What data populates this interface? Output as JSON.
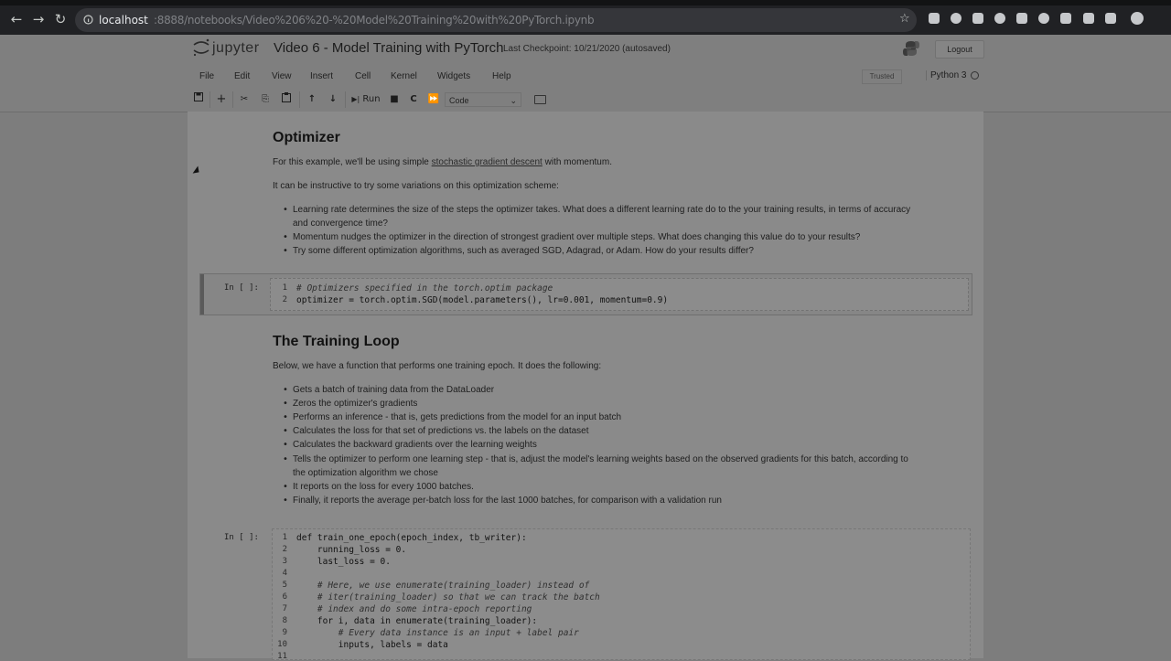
{
  "browser": {
    "url_host": "localhost",
    "url_path": ":8888/notebooks/Video%206%20-%20Model%20Training%20with%20PyTorch.ipynb",
    "buttons": {
      "back": "←",
      "forward": "→",
      "reload": "↻"
    },
    "icons": [
      "star-icon",
      "extension-icon",
      "profile-icon"
    ]
  },
  "header": {
    "logo_text": "jupyter",
    "notebook_title": "Video 6 - Model Training with PyTorch",
    "checkpoint": "Last Checkpoint: 10/21/2020  (autosaved)",
    "logout_label": "Logout"
  },
  "menu": {
    "items": [
      "File",
      "Edit",
      "View",
      "Insert",
      "Cell",
      "Kernel",
      "Widgets",
      "Help"
    ],
    "trusted_label": "Trusted",
    "kernel_name": "Python 3"
  },
  "toolbar": {
    "save": "💾",
    "add": "+",
    "cut": "✂",
    "copy": "⎘",
    "paste": "📋",
    "move_up": "↑",
    "move_down": "↓",
    "run_label": "Run",
    "interrupt": "■",
    "restart": "C",
    "restart_run": "⏩",
    "cell_type": "Code"
  },
  "cells": {
    "optimizer": {
      "heading": "Optimizer",
      "p1_before": "For this example, we'll be using simple ",
      "p1_link": "stochastic gradient descent",
      "p1_after": " with momentum.",
      "p2": "It can be instructive to try some variations on this optimization scheme:",
      "bullets": [
        "Learning rate determines the size of the steps the optimizer takes. What does a different learning rate do to the your training results, in terms of accuracy",
        "and convergence time?",
        "Momentum nudges the optimizer in the direction of strongest gradient over multiple steps. What does changing this value do to your results?",
        "Try some different optimization algorithms, such as averaged SGD, Adagrad, or Adam. How do your results differ?"
      ]
    },
    "optimizer_code": {
      "prompt": "In [ ]:",
      "line_numbers": [
        "1",
        "2"
      ],
      "lines": [
        "# Optimizers specified in the torch.optim package",
        "optimizer = torch.optim.SGD(model.parameters(), lr=0.001, momentum=0.9)"
      ]
    },
    "training_loop": {
      "heading": "The Training Loop",
      "intro": "Below, we have a function that performs one training epoch. It does the following:",
      "bullets": [
        "Gets a batch of training data from the DataLoader",
        "Zeros the optimizer's gradients",
        "Performs an inference - that is, gets predictions from the model for an input batch",
        "Calculates the loss for that set of predictions vs. the labels on the dataset",
        "Calculates the backward gradients over the learning weights",
        "Tells the optimizer to perform one learning step - that is, adjust the model's learning weights based on the observed gradients for this batch, according to",
        "the optimization algorithm we chose",
        "It reports on the loss for every 1000 batches.",
        "Finally, it reports the average per-batch loss for the last 1000 batches, for comparison with a validation run"
      ]
    },
    "train_code": {
      "prompt": "In [ ]:",
      "line_numbers": [
        "1",
        "2",
        "3",
        "4",
        "5",
        "6",
        "7",
        "8",
        "9",
        "10",
        "11"
      ],
      "lines": [
        "def train_one_epoch(epoch_index, tb_writer):",
        "    running_loss = 0.",
        "    last_loss = 0.",
        "",
        "    # Here, we use enumerate(training_loader) instead of",
        "    # iter(training_loader) so that we can track the batch",
        "    # index and do some intra-epoch reporting",
        "    for i, data in enumerate(training_loader):",
        "        # Every data instance is an input + label pair",
        "        inputs, labels = data",
        ""
      ]
    }
  }
}
